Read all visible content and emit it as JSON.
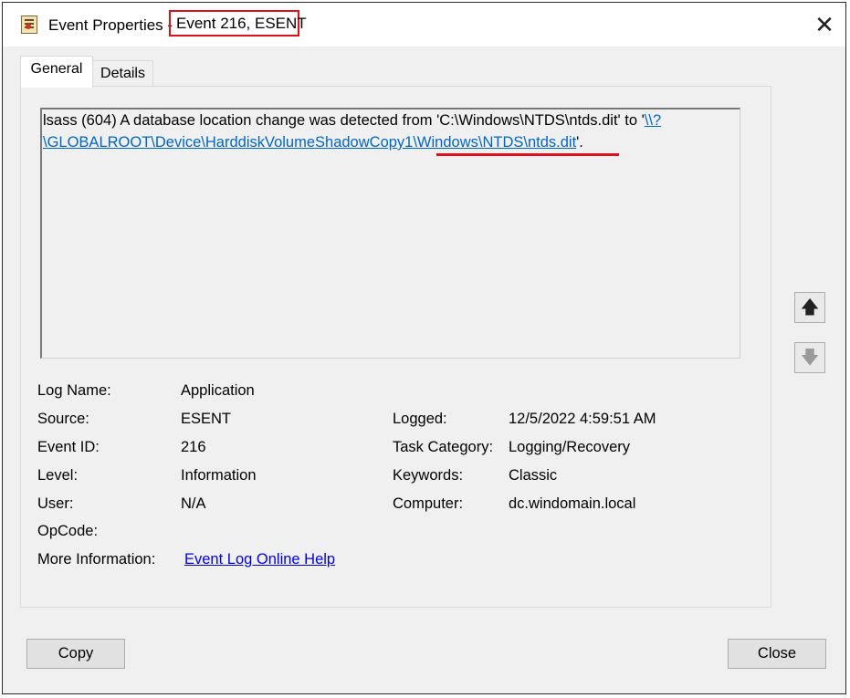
{
  "window": {
    "title_prefix": "Event Properties -",
    "title_event": "Event 216, ESENT",
    "close_glyph": "✕"
  },
  "tabs": [
    {
      "label": "General"
    },
    {
      "label": "Details"
    }
  ],
  "description": {
    "line1_text": "lsass (604) A database location change was detected from 'C:\\Windows\\NTDS\\ntds.dit' to '",
    "line1_link": "\\\\?",
    "line2_link": "\\GLOBALROOT\\Device\\HarddiskVolumeShadowCopy1\\Windows\\NTDS\\ntds.dit",
    "line2_tail": "'."
  },
  "fields": {
    "log_name_label": "Log Name:",
    "log_name_value": "Application",
    "source_label": "Source:",
    "source_value": "ESENT",
    "event_id_label": "Event ID:",
    "event_id_value": "216",
    "level_label": "Level:",
    "level_value": "Information",
    "user_label": "User:",
    "user_value": "N/A",
    "opcode_label": "OpCode:",
    "opcode_value": "",
    "more_info_label": "More Information:",
    "more_info_link": "Event Log Online Help",
    "logged_label": "Logged:",
    "logged_value": "12/5/2022 4:59:51 AM",
    "task_category_label": "Task Category:",
    "task_category_value": "Logging/Recovery",
    "keywords_label": "Keywords:",
    "keywords_value": "Classic",
    "computer_label": "Computer:",
    "computer_value": "dc.windomain.local"
  },
  "nav": {
    "up_icon": "arrow-up-icon",
    "down_icon": "arrow-down-icon",
    "up_glyph": "🡅",
    "down_glyph": "🡇"
  },
  "buttons": {
    "copy": "Copy",
    "close": "Close"
  },
  "colors": {
    "highlight_red": "#e0101a",
    "link_blue": "#0066cc"
  }
}
